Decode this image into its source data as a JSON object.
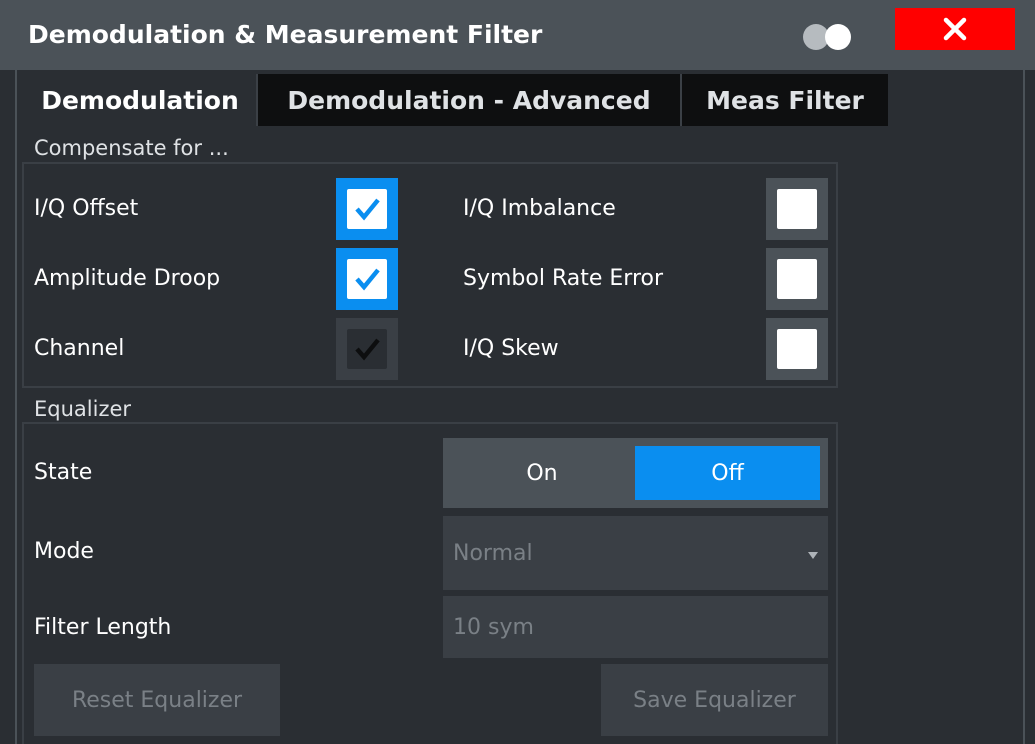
{
  "window": {
    "title": "Demodulation & Measurement Filter",
    "close_label": "✕"
  },
  "tabs": [
    {
      "label": "Demodulation",
      "active": true
    },
    {
      "label": "Demodulation - Advanced",
      "active": false
    },
    {
      "label": "Meas Filter",
      "active": false
    }
  ],
  "compensate": {
    "section_label": "Compensate for ...",
    "items": [
      {
        "label": "I/Q Offset",
        "checked": true
      },
      {
        "label": "I/Q Imbalance",
        "checked": false
      },
      {
        "label": "Amplitude Droop",
        "checked": true
      },
      {
        "label": "Symbol Rate Error",
        "checked": false
      },
      {
        "label": "Channel",
        "checked": true,
        "disabled": true
      },
      {
        "label": "I/Q Skew",
        "checked": false
      }
    ]
  },
  "equalizer": {
    "section_label": "Equalizer",
    "state_label": "State",
    "state_on": "On",
    "state_off": "Off",
    "state_selected": "Off",
    "mode_label": "Mode",
    "mode_value": "Normal",
    "filter_length_label": "Filter Length",
    "filter_length_value": "10 sym",
    "reset_button": "Reset Equalizer",
    "save_button": "Save Equalizer"
  },
  "colors": {
    "accent": "#0a8ef0",
    "close": "#ff0000",
    "titlebar": "#4b5258",
    "background": "#2a2e33"
  }
}
